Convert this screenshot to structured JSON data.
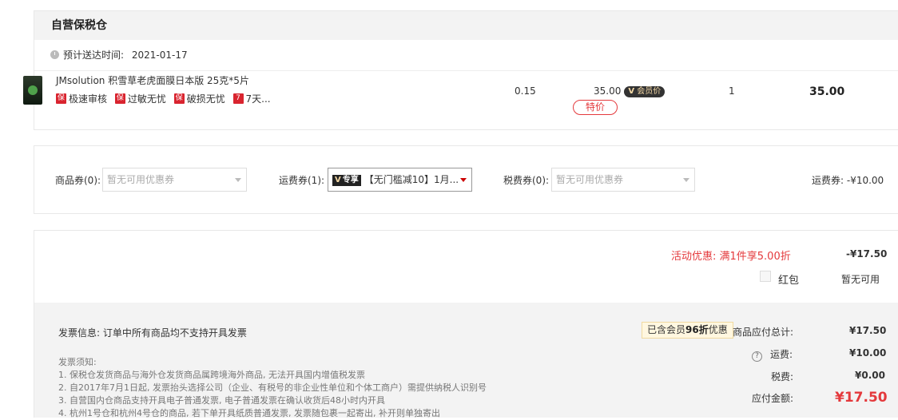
{
  "warehouse": {
    "title": "自营保税仓",
    "eta_label": "预计送达时间:",
    "eta_date": "2021-01-17"
  },
  "product": {
    "name": "JMsolution 积雪草老虎面膜日本版 25克*5片",
    "tags": [
      {
        "icon": "保",
        "label": "极速审核"
      },
      {
        "icon": "保",
        "label": "过敏无忧"
      },
      {
        "icon": "保",
        "label": "破损无忧"
      },
      {
        "icon": "7",
        "label": "7天..."
      }
    ],
    "weight": "0.15",
    "price": "35.00",
    "member_badge": "会员价",
    "member_badge_mark": "V",
    "special_label": "特价",
    "quantity": "1",
    "subtotal": "35.00"
  },
  "coupons": {
    "goods_label": "商品券(0):",
    "goods_placeholder": "暂无可用优惠券",
    "shipping_label": "运费券(1):",
    "shipping_tag_mark": "V",
    "shipping_tag": "专享",
    "shipping_value": "【无门槛减10】1月...",
    "tax_label": "税费券(0):",
    "tax_placeholder": "暂无可用优惠券",
    "shipping_discount": "运费券: -¥10.00"
  },
  "promotion": {
    "label": "活动优惠: 满1件享5.00折",
    "value": "-¥17.50",
    "red_packet_label": "红包",
    "red_packet_value": "暂无可用"
  },
  "invoice": {
    "info": "发票信息: 订单中所有商品均不支持开具发票",
    "notes_title": "发票须知:",
    "notes": [
      "1. 保税仓发货商品与海外仓发货商品属跨境海外商品, 无法开具国内增值税发票",
      "2. 自2017年7月1日起, 发票抬头选择公司（企业、有税号的非企业性单位和个体工商户）需提供纳税人识别号",
      "3. 自营国内仓商品支持开具电子普通发票, 电子普通发票在确认收货后48小时内开具",
      "4. 杭州1号仓和杭州4号仓的商品, 若下单开具纸质普通发票, 发票随包裹一起寄出, 补开则单独寄出"
    ]
  },
  "summary": {
    "member_discount_pre": "已含会员",
    "member_discount_bold": "96折",
    "member_discount_post": "优惠",
    "goods_total_label": "商品应付总计:",
    "goods_total": "¥17.50",
    "shipping_label": "运费:",
    "shipping": "¥10.00",
    "tax_label": "税费:",
    "tax": "¥0.00",
    "payable_label": "应付金额:",
    "payable": "¥17.50"
  },
  "colors": {
    "accent_red": "#e4393c",
    "panel_grey": "#f3f3f3"
  }
}
